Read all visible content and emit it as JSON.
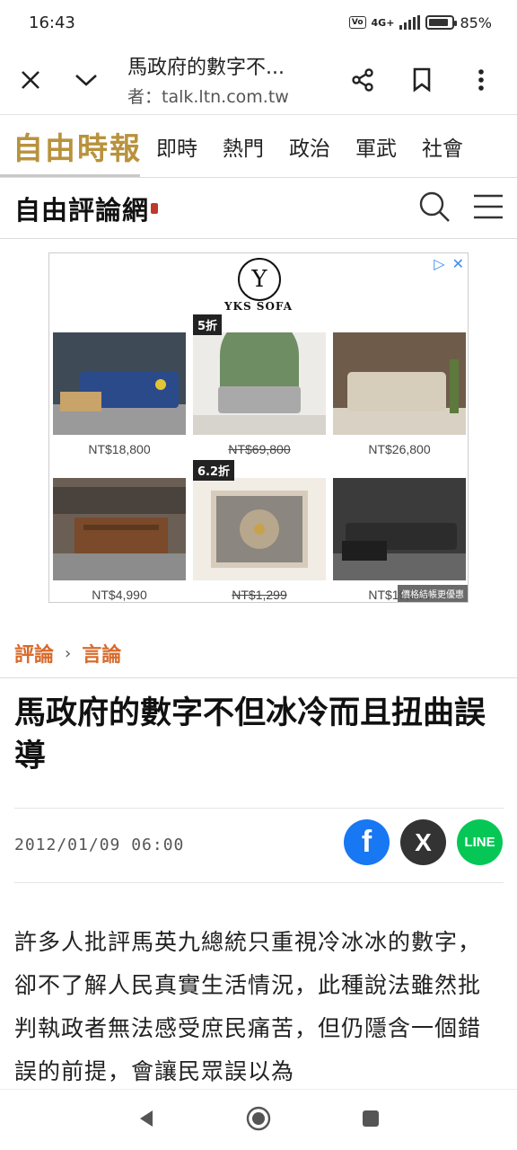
{
  "status": {
    "time": "16:43",
    "network": "4G+",
    "volte": "Vo LTE",
    "battery_pct": 85,
    "battery_label": "85%"
  },
  "browser": {
    "title": "馬政府的數字不...",
    "url": "者：talk.ltn.com.tw"
  },
  "site": {
    "logo": "自由時報",
    "nav": [
      "即時",
      "熱門",
      "政治",
      "軍武",
      "社會"
    ]
  },
  "opinion": {
    "logo": "自由評論網"
  },
  "ad": {
    "brand_mark": "Y",
    "brand": "YKS SOFA",
    "items": [
      {
        "price": "NT$18,800",
        "badge": "",
        "strike": false
      },
      {
        "price": "NT$69,800",
        "badge": "5折",
        "strike": true
      },
      {
        "price": "NT$26,800",
        "badge": "",
        "strike": false
      },
      {
        "price": "NT$4,990",
        "badge": "",
        "strike": false
      },
      {
        "price": "NT$1,299",
        "badge": "6.2折",
        "strike": true
      },
      {
        "price": "NT$19,800",
        "badge": "",
        "strike": false
      }
    ],
    "note": "價格結帳更優惠"
  },
  "breadcrumb": {
    "section": "評論",
    "subsection": "言論"
  },
  "article": {
    "title": "馬政府的數字不但冰冷而且扭曲誤導",
    "date": "2012/01/09 06:00",
    "body": "許多人批評馬英九總統只重視冷冰冰的數字，卻不了解人民真實生活情況，此種說法雖然批判執政者無法感受庶民痛苦，但仍隱含一個錯誤的前提，會讓民眾誤以為"
  },
  "share": {
    "facebook": "f",
    "x": "X",
    "line": "LINE"
  },
  "colors": {
    "accent": "#d86a2b",
    "logo_gold": "#b8923d",
    "facebook": "#1877f2",
    "x": "#333333",
    "line": "#06c755"
  }
}
